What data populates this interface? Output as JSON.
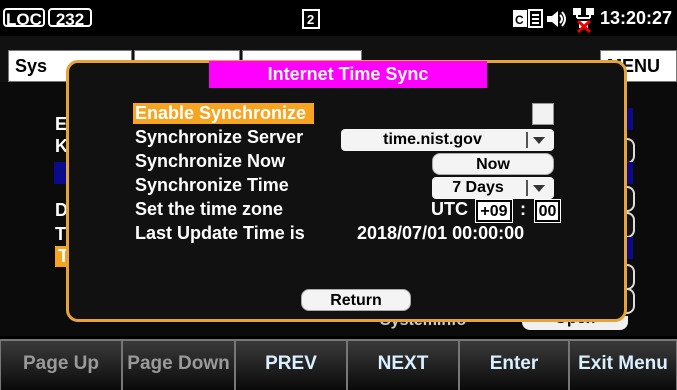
{
  "statusbar": {
    "mode": "LOC",
    "interface": "232",
    "clock": "13:20:27"
  },
  "tabs": [
    {
      "label": "Sys"
    },
    {
      "label": ""
    },
    {
      "label": ""
    },
    {
      "label": "MENU"
    }
  ],
  "underlay": {
    "row_initials": [
      "E",
      "K",
      "D",
      "T",
      "T"
    ],
    "peek_text": "SystemInfo",
    "peek_button": "Open"
  },
  "dialog": {
    "title": "Internet Time Sync",
    "rows": {
      "enable_label": "Enable Synchronize",
      "server_label": "Synchronize Server",
      "now_label": "Synchronize Now",
      "time_label": "Synchronize Time",
      "tz_label": "Set the time zone",
      "last_label": "Last Update Time is"
    },
    "server_value": "time.nist.gov",
    "now_button": "Now",
    "interval_value": "7 Days",
    "tz_prefix": "UTC",
    "tz_hours": "+09",
    "tz_sep": ":",
    "tz_minutes": "00",
    "last_update": "2018/07/01 00:00:00",
    "return_button": "Return"
  },
  "softkeys": [
    "Page Up",
    "Page Down",
    "PREV",
    "NEXT",
    "Enter",
    "Exit Menu"
  ],
  "colors": {
    "highlight": "#f7a420",
    "title_bg": "#ff00ff",
    "dialog_border": "#e8a338"
  }
}
